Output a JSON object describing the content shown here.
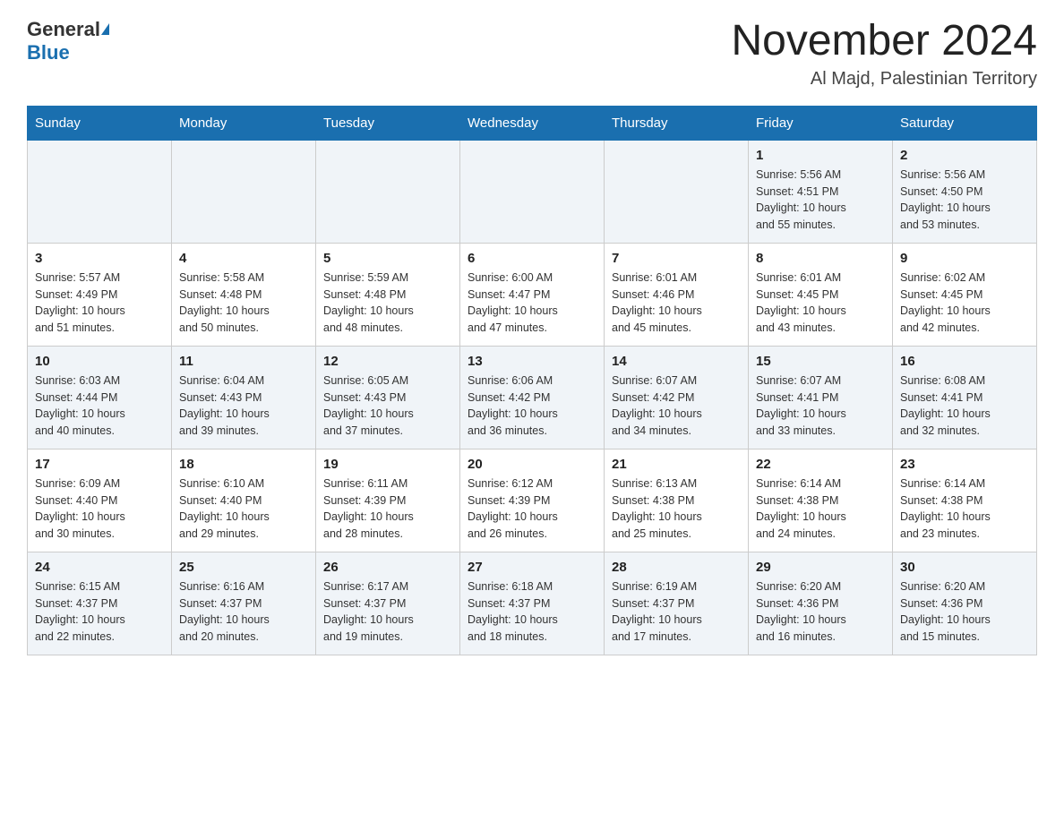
{
  "header": {
    "logo_general": "General",
    "logo_blue": "Blue",
    "month_title": "November 2024",
    "location": "Al Majd, Palestinian Territory"
  },
  "days_of_week": [
    "Sunday",
    "Monday",
    "Tuesday",
    "Wednesday",
    "Thursday",
    "Friday",
    "Saturday"
  ],
  "weeks": [
    {
      "days": [
        {
          "num": "",
          "info": ""
        },
        {
          "num": "",
          "info": ""
        },
        {
          "num": "",
          "info": ""
        },
        {
          "num": "",
          "info": ""
        },
        {
          "num": "",
          "info": ""
        },
        {
          "num": "1",
          "info": "Sunrise: 5:56 AM\nSunset: 4:51 PM\nDaylight: 10 hours\nand 55 minutes."
        },
        {
          "num": "2",
          "info": "Sunrise: 5:56 AM\nSunset: 4:50 PM\nDaylight: 10 hours\nand 53 minutes."
        }
      ]
    },
    {
      "days": [
        {
          "num": "3",
          "info": "Sunrise: 5:57 AM\nSunset: 4:49 PM\nDaylight: 10 hours\nand 51 minutes."
        },
        {
          "num": "4",
          "info": "Sunrise: 5:58 AM\nSunset: 4:48 PM\nDaylight: 10 hours\nand 50 minutes."
        },
        {
          "num": "5",
          "info": "Sunrise: 5:59 AM\nSunset: 4:48 PM\nDaylight: 10 hours\nand 48 minutes."
        },
        {
          "num": "6",
          "info": "Sunrise: 6:00 AM\nSunset: 4:47 PM\nDaylight: 10 hours\nand 47 minutes."
        },
        {
          "num": "7",
          "info": "Sunrise: 6:01 AM\nSunset: 4:46 PM\nDaylight: 10 hours\nand 45 minutes."
        },
        {
          "num": "8",
          "info": "Sunrise: 6:01 AM\nSunset: 4:45 PM\nDaylight: 10 hours\nand 43 minutes."
        },
        {
          "num": "9",
          "info": "Sunrise: 6:02 AM\nSunset: 4:45 PM\nDaylight: 10 hours\nand 42 minutes."
        }
      ]
    },
    {
      "days": [
        {
          "num": "10",
          "info": "Sunrise: 6:03 AM\nSunset: 4:44 PM\nDaylight: 10 hours\nand 40 minutes."
        },
        {
          "num": "11",
          "info": "Sunrise: 6:04 AM\nSunset: 4:43 PM\nDaylight: 10 hours\nand 39 minutes."
        },
        {
          "num": "12",
          "info": "Sunrise: 6:05 AM\nSunset: 4:43 PM\nDaylight: 10 hours\nand 37 minutes."
        },
        {
          "num": "13",
          "info": "Sunrise: 6:06 AM\nSunset: 4:42 PM\nDaylight: 10 hours\nand 36 minutes."
        },
        {
          "num": "14",
          "info": "Sunrise: 6:07 AM\nSunset: 4:42 PM\nDaylight: 10 hours\nand 34 minutes."
        },
        {
          "num": "15",
          "info": "Sunrise: 6:07 AM\nSunset: 4:41 PM\nDaylight: 10 hours\nand 33 minutes."
        },
        {
          "num": "16",
          "info": "Sunrise: 6:08 AM\nSunset: 4:41 PM\nDaylight: 10 hours\nand 32 minutes."
        }
      ]
    },
    {
      "days": [
        {
          "num": "17",
          "info": "Sunrise: 6:09 AM\nSunset: 4:40 PM\nDaylight: 10 hours\nand 30 minutes."
        },
        {
          "num": "18",
          "info": "Sunrise: 6:10 AM\nSunset: 4:40 PM\nDaylight: 10 hours\nand 29 minutes."
        },
        {
          "num": "19",
          "info": "Sunrise: 6:11 AM\nSunset: 4:39 PM\nDaylight: 10 hours\nand 28 minutes."
        },
        {
          "num": "20",
          "info": "Sunrise: 6:12 AM\nSunset: 4:39 PM\nDaylight: 10 hours\nand 26 minutes."
        },
        {
          "num": "21",
          "info": "Sunrise: 6:13 AM\nSunset: 4:38 PM\nDaylight: 10 hours\nand 25 minutes."
        },
        {
          "num": "22",
          "info": "Sunrise: 6:14 AM\nSunset: 4:38 PM\nDaylight: 10 hours\nand 24 minutes."
        },
        {
          "num": "23",
          "info": "Sunrise: 6:14 AM\nSunset: 4:38 PM\nDaylight: 10 hours\nand 23 minutes."
        }
      ]
    },
    {
      "days": [
        {
          "num": "24",
          "info": "Sunrise: 6:15 AM\nSunset: 4:37 PM\nDaylight: 10 hours\nand 22 minutes."
        },
        {
          "num": "25",
          "info": "Sunrise: 6:16 AM\nSunset: 4:37 PM\nDaylight: 10 hours\nand 20 minutes."
        },
        {
          "num": "26",
          "info": "Sunrise: 6:17 AM\nSunset: 4:37 PM\nDaylight: 10 hours\nand 19 minutes."
        },
        {
          "num": "27",
          "info": "Sunrise: 6:18 AM\nSunset: 4:37 PM\nDaylight: 10 hours\nand 18 minutes."
        },
        {
          "num": "28",
          "info": "Sunrise: 6:19 AM\nSunset: 4:37 PM\nDaylight: 10 hours\nand 17 minutes."
        },
        {
          "num": "29",
          "info": "Sunrise: 6:20 AM\nSunset: 4:36 PM\nDaylight: 10 hours\nand 16 minutes."
        },
        {
          "num": "30",
          "info": "Sunrise: 6:20 AM\nSunset: 4:36 PM\nDaylight: 10 hours\nand 15 minutes."
        }
      ]
    }
  ]
}
